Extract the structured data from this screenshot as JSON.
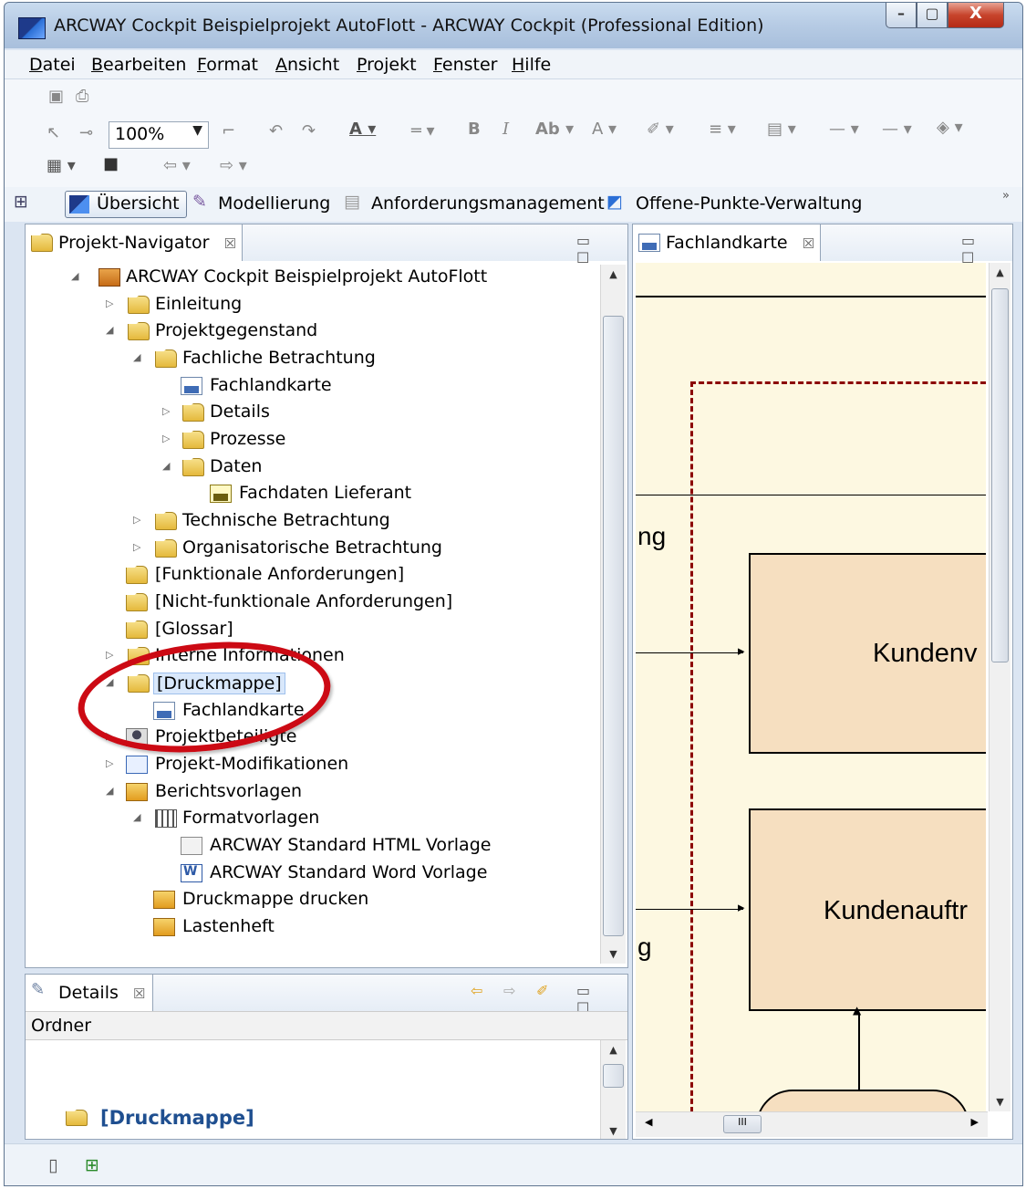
{
  "window": {
    "title": "ARCWAY Cockpit Beispielprojekt AutoFlott - ARCWAY Cockpit (Professional Edition)",
    "controls": {
      "minimize": "–",
      "maximize": "▢",
      "close": "X"
    }
  },
  "menu": [
    "Datei",
    "Bearbeiten",
    "Format",
    "Ansicht",
    "Projekt",
    "Fenster",
    "Hilfe"
  ],
  "toolbar": {
    "zoom": "100%"
  },
  "perspectives": {
    "overflow": "»",
    "items": [
      "Übersicht",
      "Modellierung",
      "Anforderungsmanagement",
      "Offene-Punkte-Verwaltung"
    ],
    "active": "Übersicht"
  },
  "navigator": {
    "title": "Projekt-Navigator",
    "close": "☒",
    "tree": [
      {
        "label": "ARCWAY Cockpit Beispielprojekt AutoFlott",
        "icon": "project-icon",
        "expanded": true
      },
      {
        "label": "Einleitung",
        "icon": "folder-icon",
        "expanded": false
      },
      {
        "label": "Projektgegenstand",
        "icon": "folder-icon",
        "expanded": true
      },
      {
        "label": "Fachliche Betrachtung",
        "icon": "folder-icon",
        "expanded": true
      },
      {
        "label": "Fachlandkarte",
        "icon": "fmc-diagram-icon"
      },
      {
        "label": "Details",
        "icon": "folder-icon",
        "expanded": false
      },
      {
        "label": "Prozesse",
        "icon": "folder-icon",
        "expanded": false
      },
      {
        "label": "Daten",
        "icon": "folder-icon",
        "expanded": true
      },
      {
        "label": "Fachdaten Lieferant",
        "icon": "uml-diagram-icon"
      },
      {
        "label": "Technische Betrachtung",
        "icon": "folder-icon",
        "expanded": false
      },
      {
        "label": "Organisatorische Betrachtung",
        "icon": "folder-icon",
        "expanded": false
      },
      {
        "label": "[Funktionale Anforderungen]",
        "icon": "folder-icon"
      },
      {
        "label": "[Nicht-funktionale Anforderungen]",
        "icon": "folder-icon"
      },
      {
        "label": "[Glossar]",
        "icon": "folder-icon"
      },
      {
        "label": "Interne Informationen",
        "icon": "folder-icon",
        "expanded": false
      },
      {
        "label": "[Druckmappe]",
        "icon": "print-folder-icon",
        "expanded": true,
        "selected": true
      },
      {
        "label": "Fachlandkarte",
        "icon": "fmc-diagram-icon"
      },
      {
        "label": "Projektbeteiligte",
        "icon": "users-icon",
        "expanded": false
      },
      {
        "label": "Projekt-Modifikationen",
        "icon": "modifications-icon",
        "expanded": false
      },
      {
        "label": "Berichtsvorlagen",
        "icon": "report-icon",
        "expanded": true
      },
      {
        "label": "Formatvorlagen",
        "icon": "library-icon",
        "expanded": true
      },
      {
        "label": "ARCWAY Standard HTML Vorlage",
        "icon": "html-template-icon"
      },
      {
        "label": "ARCWAY Standard Word Vorlage",
        "icon": "word-template-icon"
      },
      {
        "label": "Druckmappe drucken",
        "icon": "print-report-icon"
      },
      {
        "label": "Lastenheft",
        "icon": "report-doc-icon"
      }
    ]
  },
  "details": {
    "title": "Details",
    "close": "☒",
    "type_label": "Ordner",
    "name": "[Druckmappe]"
  },
  "editor": {
    "tab": "Fachlandkarte",
    "close": "☒",
    "fragments": {
      "top": "ng",
      "bottom": "g"
    },
    "boxes": [
      "Kundenv",
      "Kundenauftr"
    ],
    "scroll_label": "III"
  }
}
